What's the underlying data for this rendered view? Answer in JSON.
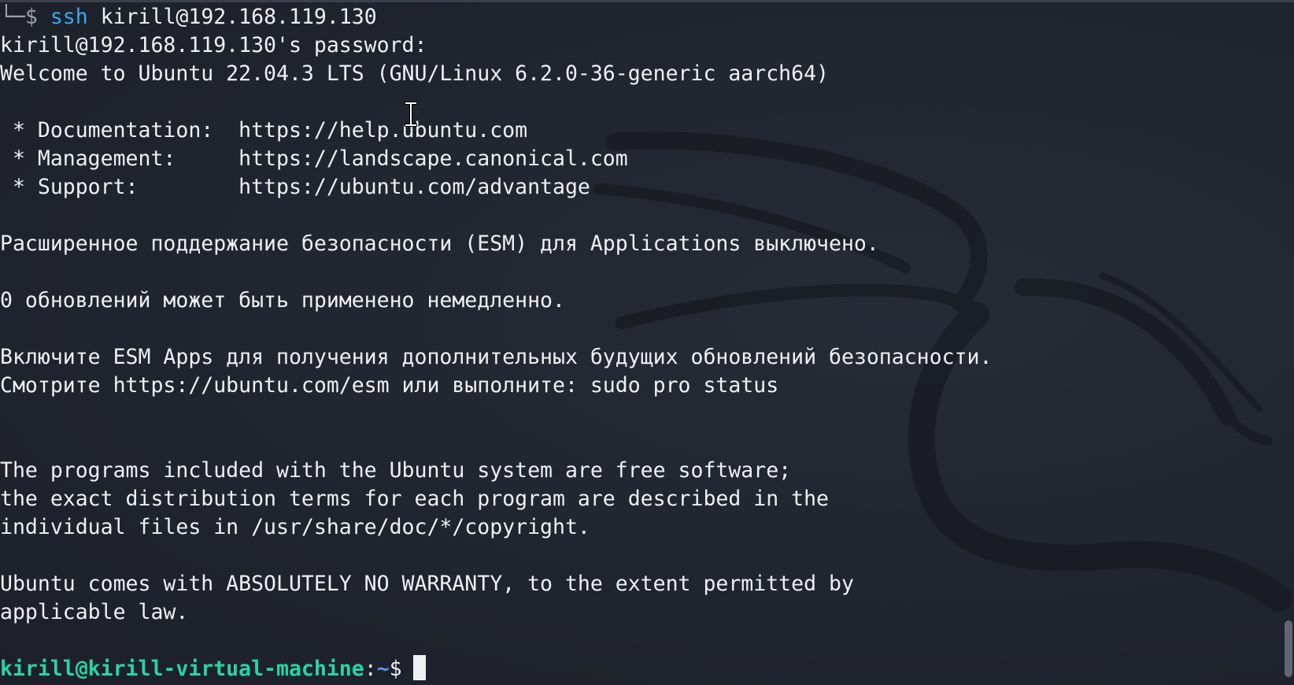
{
  "terminal": {
    "prompt_tree_glyph": "└─$",
    "command": "ssh",
    "command_args": "kirill@192.168.119.130",
    "lines": [
      "kirill@192.168.119.130's password:",
      "Welcome to Ubuntu 22.04.3 LTS (GNU/Linux 6.2.0-36-generic aarch64)",
      "",
      " * Documentation:  https://help.ubuntu.com",
      " * Management:     https://landscape.canonical.com",
      " * Support:        https://ubuntu.com/advantage",
      "",
      "Расширенное поддержание безопасности (ESM) для Applications выключено.",
      "",
      "0 обновлений может быть применено немедленно.",
      "",
      "Включите ESM Apps для получения дополнительных будущих обновлений безопасности.",
      "Смотрите https://ubuntu.com/esm или выполните: sudo pro status",
      "",
      "",
      "The programs included with the Ubuntu system are free software;",
      "the exact distribution terms for each program are described in the",
      "individual files in /usr/share/doc/*/copyright.",
      "",
      "Ubuntu comes with ABSOLUTELY NO WARRANTY, to the extent permitted by",
      "applicable law.",
      ""
    ],
    "final_prompt": {
      "user_host": "kirill@kirill-virtual-machine",
      "separator": ":",
      "path": "~",
      "dollar": "$"
    }
  },
  "colors": {
    "background": "#20242e",
    "text": "#eef0f4",
    "command": "#38a8f0",
    "prompt_user": "#29d4a4",
    "prompt_path": "#5a93f2"
  },
  "icons": {
    "watermark": "kali-dragon-watermark-icon",
    "pointer": "i-beam-cursor-icon"
  }
}
